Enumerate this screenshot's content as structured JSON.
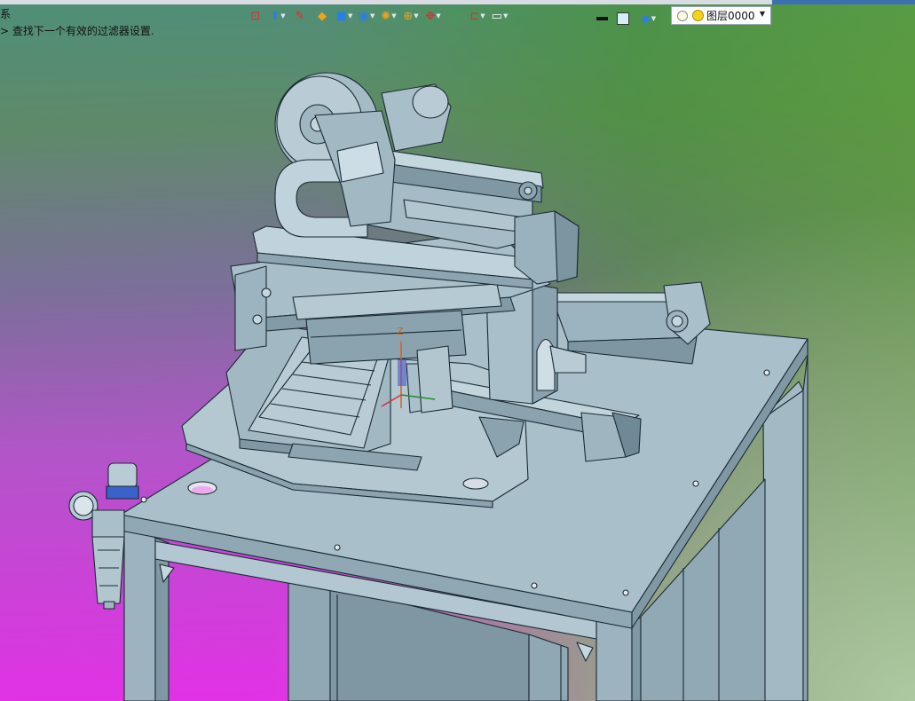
{
  "status": {
    "line1": "系",
    "line2": "> 查找下一个有效的过滤器设置."
  },
  "toolbar": {
    "tools": [
      {
        "icon": "frame-icon",
        "glyph": "⊡",
        "cls": "ico-red"
      },
      {
        "icon": "pin-icon",
        "glyph": "⬆",
        "cls": "ico-blue",
        "dropdown": true
      },
      {
        "icon": "brush-icon",
        "glyph": "✎",
        "cls": "ico-red"
      },
      {
        "icon": "eraser-icon",
        "glyph": "◆",
        "cls": "ico-orange"
      },
      {
        "icon": "solid-cube-icon",
        "glyph": "■",
        "cls": "ico-blue",
        "dropdown": true
      },
      {
        "icon": "view-cube-icon",
        "glyph": "▣",
        "cls": "ico-blue",
        "dropdown": true
      },
      {
        "icon": "render-sphere-icon",
        "glyph": "✺",
        "cls": "ico-orange",
        "dropdown": true
      },
      {
        "icon": "zoom-icon",
        "glyph": "⊕",
        "cls": "ico-orange",
        "dropdown": true
      },
      {
        "icon": "move-axis-icon",
        "glyph": "✥",
        "cls": "ico-red",
        "dropdown": true
      },
      {
        "icon": "select-box-icon",
        "glyph": "▢",
        "cls": "ico-green"
      },
      {
        "icon": "bracket-icon",
        "glyph": "⊏",
        "cls": "ico-red",
        "dropdown": true
      },
      {
        "icon": "monitor-icon",
        "glyph": "▭",
        "cls": "",
        "dropdown": true
      }
    ],
    "color_swatch": "#111111",
    "fill_swatch": "#d8eef7"
  },
  "layer": {
    "label": "图层0000"
  },
  "scene": {
    "axis_label": "Z"
  },
  "colors": {
    "metal": "#a9bfca",
    "metal_dark": "#7f98a4",
    "metal_light": "#c4d6de",
    "edge": "#1a2a33"
  }
}
